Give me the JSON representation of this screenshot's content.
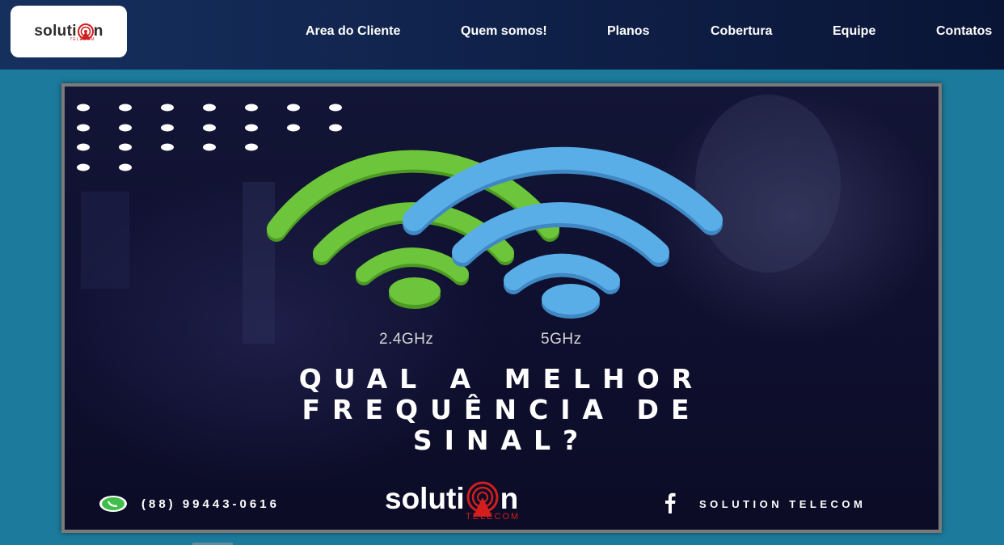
{
  "header": {
    "logo": {
      "word_start": "soluti",
      "word_end": "n",
      "subtitle": "TELECOM"
    },
    "nav": [
      {
        "label": "Area do Cliente"
      },
      {
        "label": "Quem somos!"
      },
      {
        "label": "Planos"
      },
      {
        "label": "Cobertura"
      },
      {
        "label": "Equipe"
      },
      {
        "label": "Contatos"
      }
    ]
  },
  "banner": {
    "band_24": "2.4GHz",
    "band_5": "5GHz",
    "headline": [
      "QUAL A MELHOR",
      "FREQUÊNCIA DE",
      "SINAL?"
    ],
    "phone": "(88) 99443-0616",
    "brand_start": "soluti",
    "brand_end": "n",
    "brand_sub": "TELECOM",
    "social": "SOLUTION TELECOM"
  },
  "colors": {
    "nav_bg": "#0f2048",
    "page_bg": "#1c7a9c",
    "wifi_green": "#6cc53a",
    "wifi_blue": "#5aaee8",
    "brand_red": "#d21e1e"
  }
}
